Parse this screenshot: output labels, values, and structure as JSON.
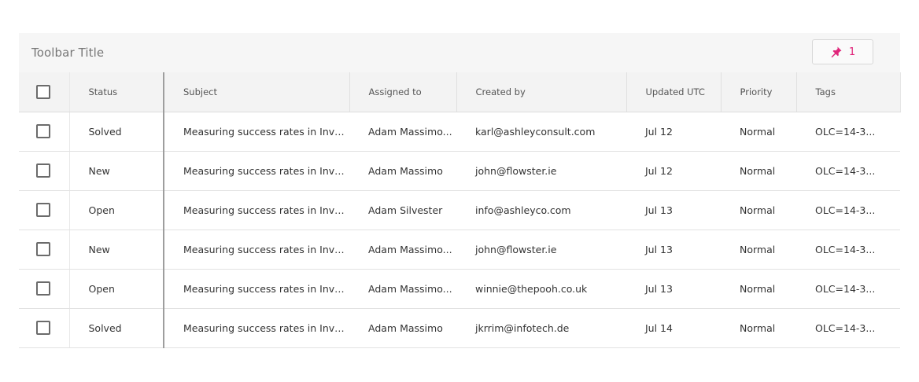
{
  "toolbar": {
    "title": "Toolbar Title",
    "pin_icon": "pin-icon",
    "pin_count": "1",
    "accent_color": "#e0257a"
  },
  "columns": [
    "Status",
    "Subject",
    "Assigned to",
    "Created by",
    "Updated UTC",
    "Priority",
    "Tags"
  ],
  "rows": [
    {
      "status": "Solved",
      "subject": "Measuring success rates in Investi...",
      "assigned": "Adam Massimo...",
      "created_by": "karl@ashleyconsult.com",
      "updated": "Jul 12",
      "priority": "Normal",
      "tags": "OLC=14-3..."
    },
    {
      "status": "New",
      "subject": "Measuring success rates in Investi...",
      "assigned": "Adam Massimo",
      "created_by": "john@flowster.ie",
      "updated": "Jul 12",
      "priority": "Normal",
      "tags": "OLC=14-3..."
    },
    {
      "status": "Open",
      "subject": "Measuring success rates in Investi...",
      "assigned": "Adam Silvester",
      "created_by": "info@ashleyco.com",
      "updated": "Jul 13",
      "priority": "Normal",
      "tags": "OLC=14-3..."
    },
    {
      "status": "New",
      "subject": "Measuring success rates in Investi...",
      "assigned": "Adam Massimo...",
      "created_by": "john@flowster.ie",
      "updated": "Jul 13",
      "priority": "Normal",
      "tags": "OLC=14-3..."
    },
    {
      "status": "Open",
      "subject": "Measuring success rates in Investi...",
      "assigned": "Adam Massimo...",
      "created_by": "winnie@thepooh.co.uk",
      "updated": "Jul 13",
      "priority": "Normal",
      "tags": "OLC=14-3..."
    },
    {
      "status": "Solved",
      "subject": "Measuring success rates in Investi...",
      "assigned": "Adam Massimo",
      "created_by": "jkrrim@infotech.de",
      "updated": "Jul 14",
      "priority": "Normal",
      "tags": "OLC=14-3..."
    }
  ]
}
